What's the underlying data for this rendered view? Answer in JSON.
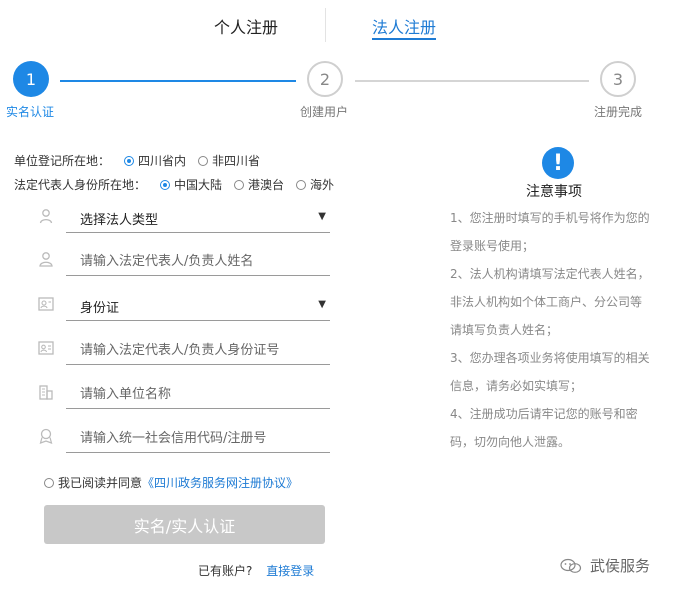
{
  "tabs": {
    "personal": "个人注册",
    "legal": "法人注册"
  },
  "steps": [
    {
      "num": "1",
      "label": "实名认证"
    },
    {
      "num": "2",
      "label": "创建用户"
    },
    {
      "num": "3",
      "label": "注册完成"
    }
  ],
  "location": {
    "label": "单位登记所在地：",
    "options": [
      "四川省内",
      "非四川省"
    ],
    "selected": "四川省内"
  },
  "identity_location": {
    "label": "法定代表人身份所在地：",
    "options": [
      "中国大陆",
      "港澳台",
      "海外"
    ],
    "selected": "中国大陆"
  },
  "form": {
    "legal_type": {
      "value": "选择法人类型",
      "icon": "person-outline-icon"
    },
    "name": {
      "placeholder": "请输入法定代表人/负责人姓名",
      "icon": "user-icon"
    },
    "id_type": {
      "value": "身份证",
      "icon": "id-card-icon"
    },
    "id_number": {
      "placeholder": "请输入法定代表人/负责人身份证号",
      "icon": "id-card-icon"
    },
    "unit_name": {
      "placeholder": "请输入单位名称",
      "icon": "building-icon"
    },
    "credit_code": {
      "placeholder": "请输入统一社会信用代码/注册号",
      "icon": "badge-icon"
    }
  },
  "agreement": {
    "prefix": "我已阅读并同意",
    "link": "《四川政务服务网注册协议》"
  },
  "submit_label": "实名/实人认证",
  "login": {
    "prompt": "已有账户?",
    "link": "直接登录"
  },
  "notice": {
    "icon_glyph": "!",
    "title": "注意事项",
    "lines": [
      "1、您注册时填写的手机号将作为您的",
      "登录账号使用；",
      "2、法人机构请填写法定代表人姓名，",
      "非法人机构如个体工商户、分公司等",
      "请填写负责人姓名；",
      "3、您办理各项业务将使用填写的相关",
      "信息，请务必如实填写；",
      "4、注册成功后请牢记您的账号和密",
      "码，切勿向他人泄露。"
    ]
  },
  "watermark": "武侯服务",
  "colors": {
    "accent": "#1e88e5",
    "button_disabled": "#c8c8c8"
  }
}
